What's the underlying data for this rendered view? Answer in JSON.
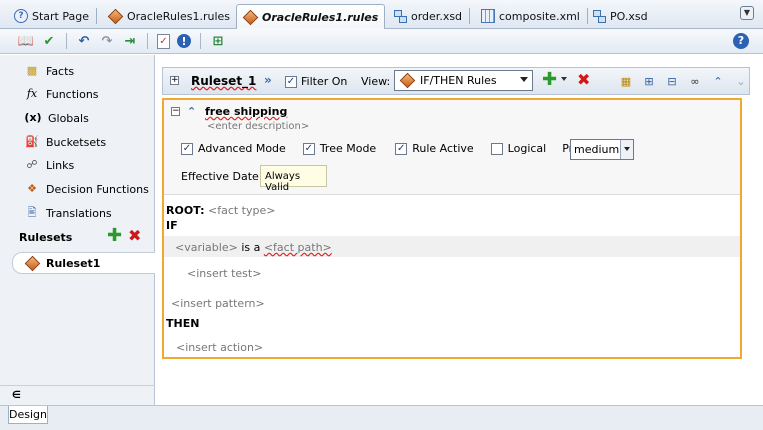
{
  "tabs": [
    {
      "label": "Start Page",
      "icon": "help-page-icon"
    },
    {
      "label": "OracleRules1.rules",
      "icon": "rules-diamond-icon"
    },
    {
      "label": "OracleRules1.rules",
      "icon": "rules-diamond-icon",
      "active": true
    },
    {
      "label": "order.xsd",
      "icon": "schema-icon"
    },
    {
      "label": "composite.xml",
      "icon": "composite-icon"
    },
    {
      "label": "PO.xsd",
      "icon": "schema-icon"
    }
  ],
  "toolbar": {
    "icons": [
      "open-book-icon",
      "validate-check-icon",
      "undo-icon",
      "redo-icon",
      "export-icon",
      "test-icon",
      "info-icon",
      "deploy-icon"
    ],
    "help": "?"
  },
  "sidebar": {
    "items": [
      {
        "label": "Facts",
        "icon": "facts-icon"
      },
      {
        "label": "Functions",
        "icon": "function-fx-icon"
      },
      {
        "label": "Globals",
        "icon": "globals-x-icon"
      },
      {
        "label": "Bucketsets",
        "icon": "bucketsets-icon"
      },
      {
        "label": "Links",
        "icon": "links-icon"
      },
      {
        "label": "Decision Functions",
        "icon": "decision-functions-icon"
      },
      {
        "label": "Translations",
        "icon": "translations-icon"
      }
    ],
    "rulesets_heading": "Rulesets",
    "rulesets": [
      "Ruleset1"
    ],
    "collapse_glyph": "∈"
  },
  "bottom": {
    "design_tab": "Design"
  },
  "ruleset": {
    "name": "Ruleset_1",
    "filter_label": "Filter On",
    "filter_checked": true,
    "view_label": "View:",
    "view_value": "IF/THEN Rules"
  },
  "rule": {
    "name": "free shipping",
    "description_placeholder": "<enter description>",
    "options": {
      "advanced_mode": {
        "label": "Advanced Mode",
        "checked": true
      },
      "tree_mode": {
        "label": "Tree Mode",
        "checked": true
      },
      "rule_active": {
        "label": "Rule Active",
        "checked": true
      },
      "logical": {
        "label": "Logical",
        "checked": false
      }
    },
    "priority_label": "Priority:",
    "priority_value": "medium",
    "effective_date_label": "Effective Date:",
    "effective_date_value": "Always Valid",
    "body": {
      "root_keyword": "ROOT:",
      "root_placeholder": "<fact type>",
      "if_keyword": "IF",
      "variable_placeholder": "<variable>",
      "is_a": "is a",
      "fact_path_placeholder": "<fact path>",
      "insert_test": "<insert test>",
      "insert_pattern": "<insert pattern>",
      "then_keyword": "THEN",
      "insert_action": "<insert action>"
    }
  },
  "colors": {
    "accent_border": "#f0a830",
    "add_green": "#2a9a2a",
    "delete_red": "#d01818"
  }
}
